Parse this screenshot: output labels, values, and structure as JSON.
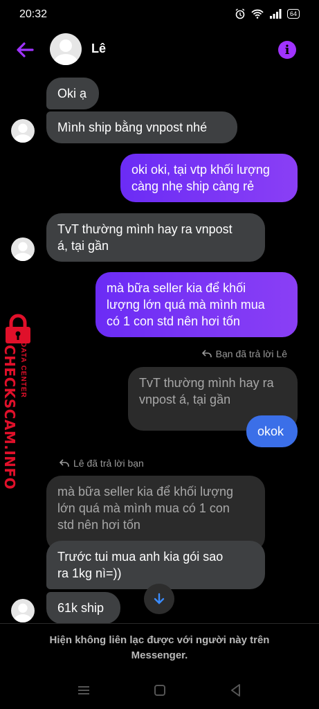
{
  "status_bar": {
    "time": "20:32",
    "battery": "64"
  },
  "header": {
    "name": "Lê"
  },
  "messages": {
    "m1": "Oki ạ",
    "m2": "Mình ship bằng vnpost nhé",
    "m3": "oki oki, tại vtp khối lượng\ncàng nhẹ ship càng rẻ",
    "m4": "TvT thường mình hay ra vnpost\ná, tại gần",
    "m5": "mà bữa seller kia để khối\nlượng lớn quá mà mình mua\ncó 1 con std nên hơi tốn",
    "reply1_note": "Bạn đã trả lời Lê",
    "reply1_quote": "TvT thường mình hay ra\nvnpost á, tại gần",
    "m6": "okok",
    "reply2_note": "Lê đã trả lời bạn",
    "reply2_quote": "mà bữa seller kia để khối lượng\nlớn quá mà mình mua có 1 con\nstd nên hơi tốn",
    "m7": "Trước tui mua anh kia gói sao\nra 1kg nì=))",
    "m8": "61k ship"
  },
  "watermark": {
    "line1": "DATA CENTER",
    "line2": "CHECKSCAM.INFO"
  },
  "footer": {
    "notice": "Hiện không liên lạc được với người này trên Messenger."
  },
  "colors": {
    "accent": "#a033ff",
    "outgoing": "#7b35f5",
    "incoming": "#3e4042",
    "watermark": "#e0102a"
  },
  "icons": [
    "back-arrow-icon",
    "info-icon",
    "reply-icon",
    "scroll-down-icon",
    "nav-menu-icon",
    "nav-home-icon",
    "nav-back-icon"
  ]
}
